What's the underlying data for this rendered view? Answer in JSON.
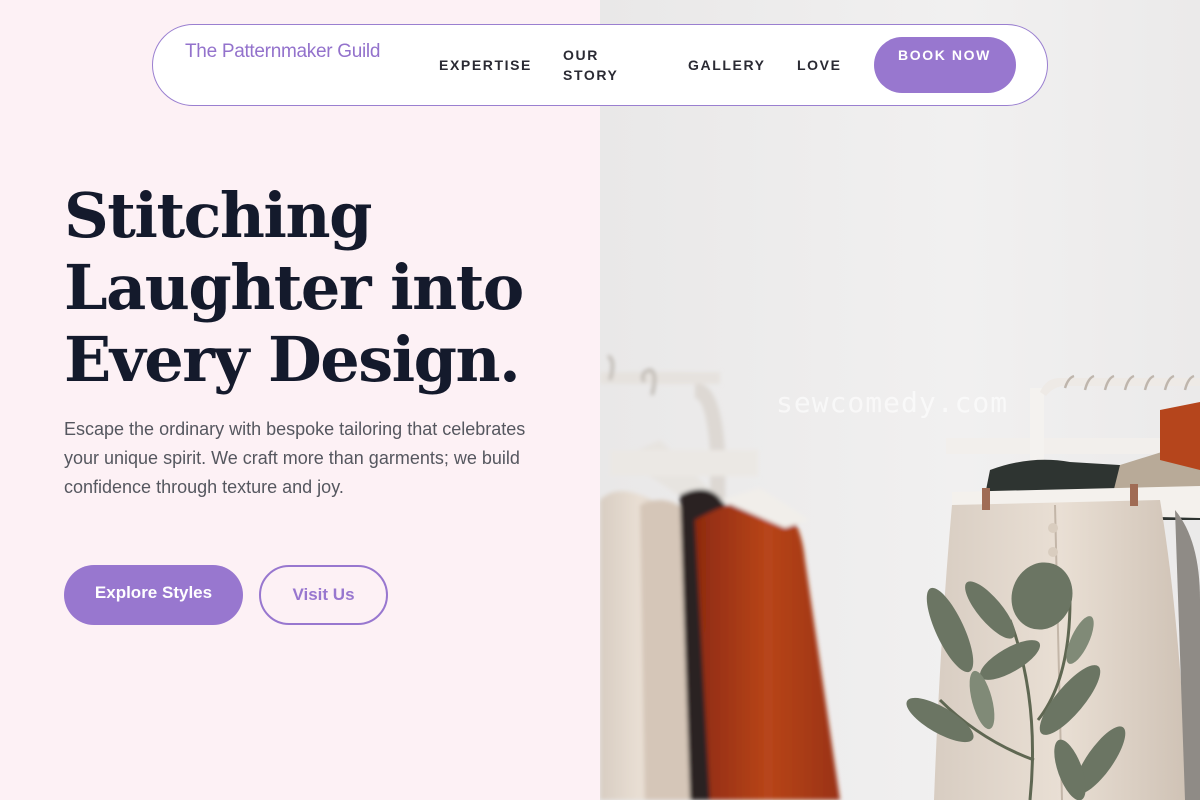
{
  "nav": {
    "brand": "The Patternmaker Guild",
    "links": [
      "EXPERTISE",
      "OUR STORY",
      "GALLERY",
      "LOVE"
    ],
    "cta": "BOOK NOW"
  },
  "hero": {
    "headline": "Stitching Laughter into Every Design.",
    "body": "Escape the ordinary with bespoke tailoring that celebrates your unique spirit. We craft more than garments; we build confidence through texture and joy.",
    "primary_button": "Explore Styles",
    "secondary_button": "Visit Us"
  },
  "image": {
    "watermark": "sewcomedy.com"
  },
  "colors": {
    "accent": "#9877cf",
    "background": "#fdf1f5",
    "heading": "#141a2c",
    "body_text": "#55575f"
  }
}
